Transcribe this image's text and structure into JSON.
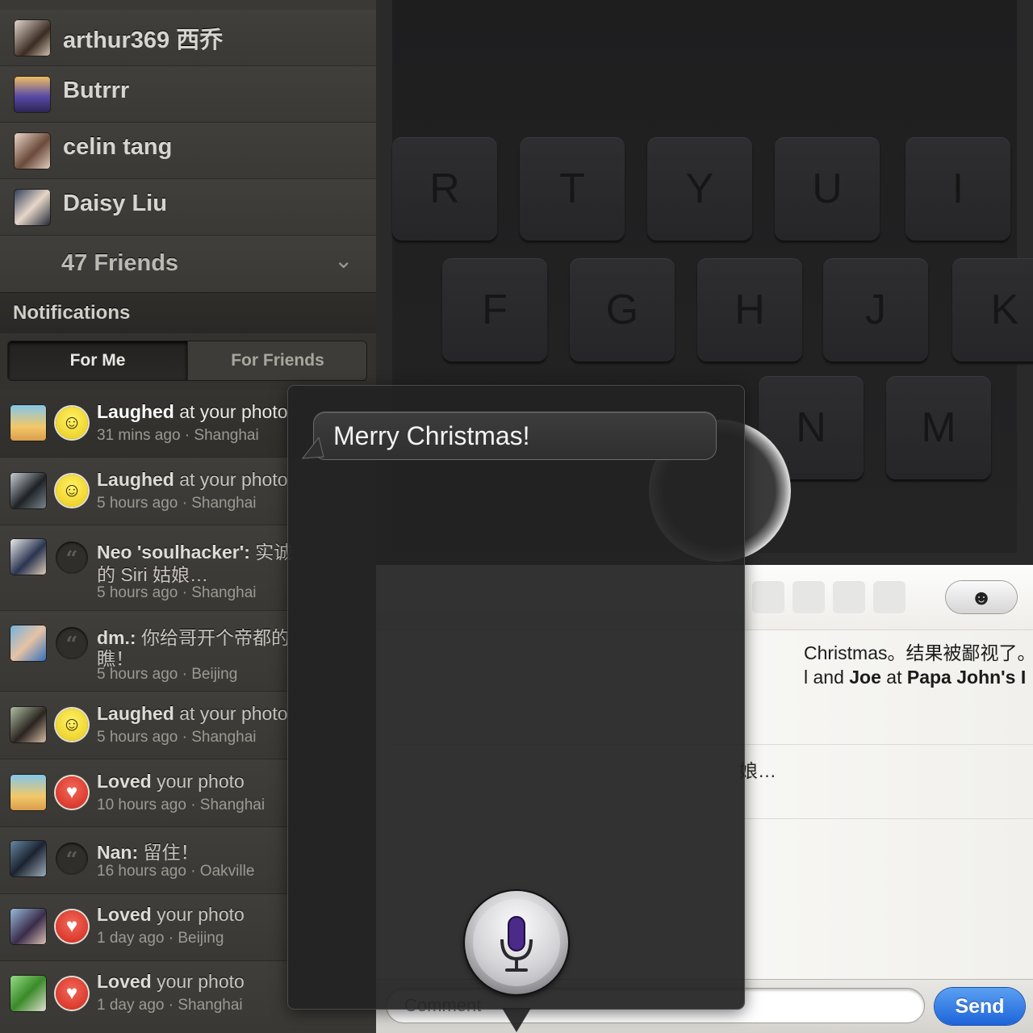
{
  "friends": {
    "items": [
      {
        "name": "arthur369 西乔"
      },
      {
        "name": "Butrrr"
      },
      {
        "name": "celin tang"
      },
      {
        "name": "Daisy Liu"
      }
    ],
    "more_label": "47 Friends"
  },
  "notifications": {
    "title": "Notifications",
    "tabs": {
      "for_me": "For Me",
      "for_friends": "For Friends",
      "selected": "For Me"
    },
    "items": [
      {
        "actor": "Laughed",
        "text": " at your photo",
        "meta": "31 mins ago · Shanghai",
        "badge": "laugh-icon"
      },
      {
        "actor": "Laughed",
        "text": " at your photo",
        "meta": "5 hours ago · Shanghai",
        "badge": "laugh-icon"
      },
      {
        "actor": "Neo 'soulhacker':",
        "text": " 实诚",
        "line2": "的 Siri 姑娘…",
        "meta": "5 hours ago · Shanghai",
        "badge": "comment-icon"
      },
      {
        "actor": "dm.:",
        "text": " 你给哥开个帝都的",
        "line2": "瞧！",
        "meta": "5 hours ago · Beijing",
        "badge": "comment-icon"
      },
      {
        "actor": "Laughed",
        "text": " at your photo",
        "meta": "5 hours ago · Shanghai",
        "badge": "laugh-icon"
      },
      {
        "actor": "Loved",
        "text": " your photo",
        "meta": "10 hours ago · Shanghai",
        "badge": "heart-icon"
      },
      {
        "actor": "Nan:",
        "text": " 留住！",
        "meta": "16 hours ago · Oakville",
        "badge": "comment-icon"
      },
      {
        "actor": "Loved",
        "text": " your photo",
        "meta": "1 day ago · Beijing",
        "badge": "heart-icon"
      },
      {
        "actor": "Loved",
        "text": " your photo",
        "meta": "1 day ago · Shanghai",
        "badge": "heart-icon"
      }
    ]
  },
  "keyboard": {
    "row1": [
      "R",
      "T",
      "Y",
      "U",
      "I"
    ],
    "row2": [
      "F",
      "G",
      "H",
      "J",
      "K"
    ],
    "row3": [
      "N",
      "M"
    ]
  },
  "post": {
    "comment_line1": "Christmas。结果被鄙视了。明",
    "comment_line2_a": "l and ",
    "comment_line2_b": "Joe",
    "comment_line2_c": " at ",
    "comment_line2_d": "Papa John's I",
    "comment_tail": "娘…",
    "emoji_glyph": "☻",
    "comment_placeholder": "Comment",
    "send_label": "Send"
  },
  "siri": {
    "recognized_text": "Merry Christmas!"
  },
  "colors": {
    "send_blue": "#1d64d9",
    "love_red": "#d4261b",
    "laugh_yellow": "#e8c713",
    "siri_mic_purple": "#4b2a8a"
  }
}
